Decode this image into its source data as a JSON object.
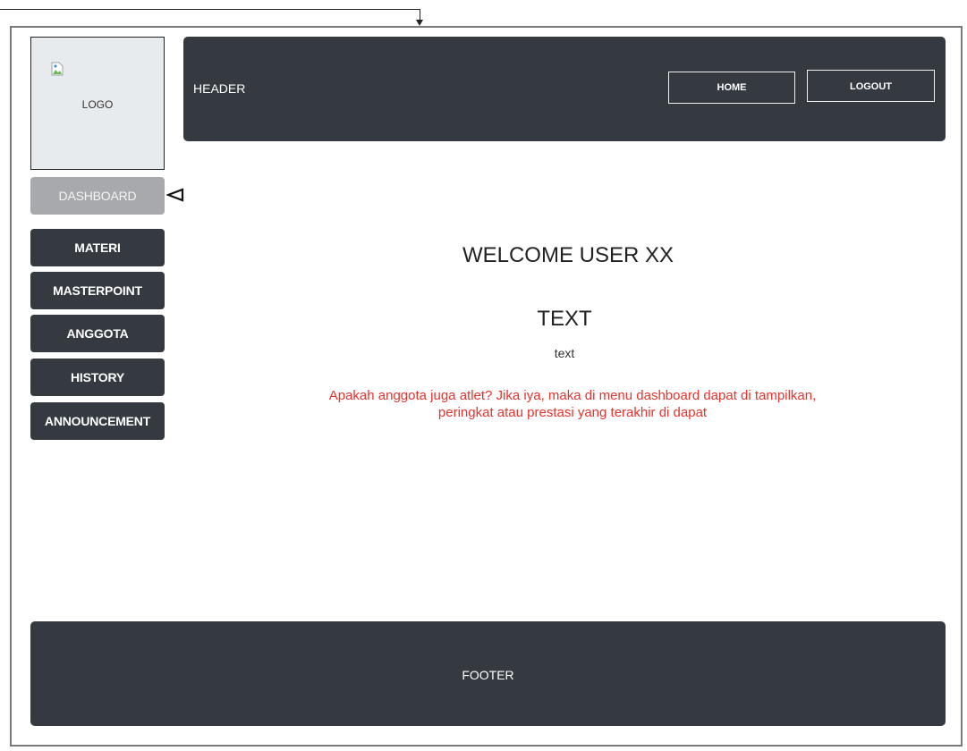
{
  "logo": {
    "label": "LOGO"
  },
  "header": {
    "title": "HEADER",
    "home_label": "HOME",
    "logout_label": "LOGOUT"
  },
  "sidebar": {
    "items": [
      {
        "label": "DASHBOARD",
        "active": true
      },
      {
        "label": "MATERI",
        "active": false
      },
      {
        "label": "MASTERPOINT",
        "active": false
      },
      {
        "label": "ANGGOTA",
        "active": false
      },
      {
        "label": "HISTORY",
        "active": false
      },
      {
        "label": "ANNOUNCEMENT",
        "active": false
      }
    ]
  },
  "main": {
    "welcome": "WELCOME USER XX",
    "heading": "TEXT",
    "subtext": "text",
    "note_line1": "Apakah anggota juga atlet? Jika iya, maka di menu dashboard dapat di tampilkan,",
    "note_line2": "peringkat atau prestasi yang terakhir di dapat"
  },
  "footer": {
    "label": "FOOTER"
  },
  "colors": {
    "dark": "#343a40",
    "active": "#a7a9ac",
    "note": "#e8322c",
    "logo_bg": "#e8ebee"
  },
  "icons": {
    "logo_image": "broken-image-icon",
    "active_marker": "triangle-pointer-icon",
    "connector": "arrow-down-icon"
  }
}
